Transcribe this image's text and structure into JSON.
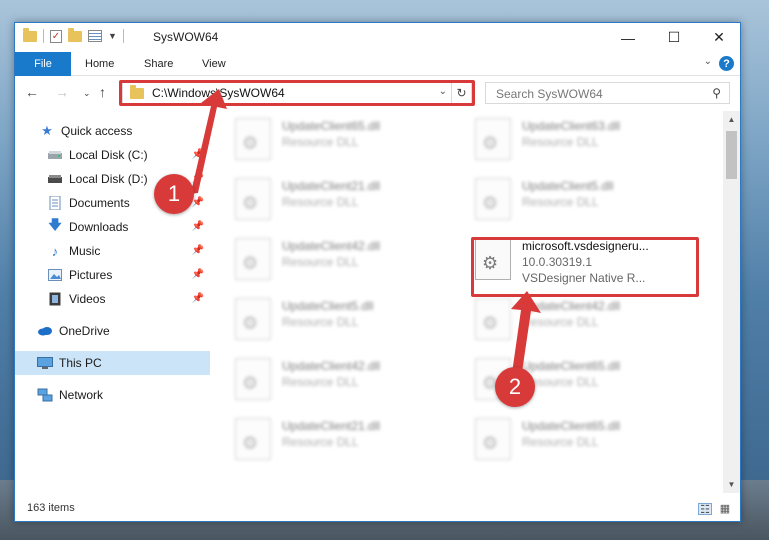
{
  "window": {
    "title": "SysWOW64",
    "minimize_glyph": "—",
    "maximize_glyph": "☐",
    "close_glyph": "✕"
  },
  "ribbon": {
    "file_tab": "File",
    "tabs": [
      "Home",
      "Share",
      "View"
    ],
    "help_glyph": "?"
  },
  "address": {
    "path": "C:\\Windows\\SysWOW64"
  },
  "search": {
    "placeholder": "Search SysWOW64"
  },
  "sidebar": {
    "items": [
      {
        "label": "Quick access",
        "icon": "star-icon",
        "pinned": false
      },
      {
        "label": "Local Disk (C:)",
        "icon": "drive-icon",
        "pinned": true
      },
      {
        "label": "Local Disk (D:)",
        "icon": "drive-icon",
        "pinned": true
      },
      {
        "label": "Documents",
        "icon": "documents-icon",
        "pinned": true
      },
      {
        "label": "Downloads",
        "icon": "download-arrow-icon",
        "pinned": true
      },
      {
        "label": "Music",
        "icon": "music-note-icon",
        "pinned": true
      },
      {
        "label": "Pictures",
        "icon": "pictures-icon",
        "pinned": true
      },
      {
        "label": "Videos",
        "icon": "videos-icon",
        "pinned": true
      },
      {
        "label": "OneDrive",
        "icon": "cloud-icon",
        "pinned": false
      },
      {
        "label": "This PC",
        "icon": "monitor-icon",
        "pinned": false,
        "selected": true
      },
      {
        "label": "Network",
        "icon": "network-icon",
        "pinned": false
      }
    ]
  },
  "files": {
    "left_column": [
      {
        "name": "UpdateClient65.dll",
        "type": "Resource DLL"
      },
      {
        "name": "UpdateClient21.dll",
        "type": "Resource DLL"
      },
      {
        "name": "UpdateClient42.dll",
        "type": "Resource DLL"
      },
      {
        "name": "UpdateClient5.dll",
        "type": "Resource DLL"
      },
      {
        "name": "UpdateClient42.dll",
        "type": "Resource DLL"
      },
      {
        "name": "UpdateClient21.dll",
        "type": "Resource DLL"
      }
    ],
    "right_column": [
      {
        "name": "UpdateClient63.dll",
        "type": "Resource DLL"
      },
      {
        "name": "UpdateClient5.dll",
        "type": "Resource DLL"
      },
      {
        "name": "microsoft.vsdesigneru...",
        "version": "10.0.30319.1",
        "type": "VSDesigner Native R...",
        "highlighted": true
      },
      {
        "name": "UpdateClient42.dll",
        "type": "Resource DLL"
      },
      {
        "name": "UpdateClient65.dll",
        "type": "Resource DLL"
      },
      {
        "name": "UpdateClient65.dll",
        "type": "Resource DLL"
      }
    ]
  },
  "status": {
    "item_count": "163 items"
  },
  "annotations": {
    "step1": "1",
    "step2": "2",
    "color": "#d83a3a"
  }
}
